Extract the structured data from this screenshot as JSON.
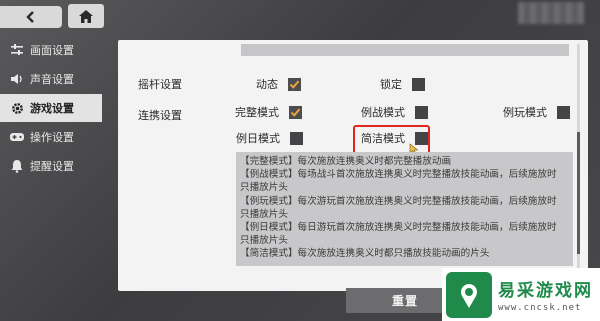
{
  "topbar": {
    "back_icon": "chevron-left",
    "home_icon": "home"
  },
  "sidebar": {
    "items": [
      {
        "label": "画面设置",
        "icon": "settings-sliders",
        "active": false
      },
      {
        "label": "声音设置",
        "icon": "speaker",
        "active": false
      },
      {
        "label": "游戏设置",
        "icon": "gear",
        "active": true
      },
      {
        "label": "操作设置",
        "icon": "gamepad",
        "active": false
      },
      {
        "label": "提醒设置",
        "icon": "bell",
        "active": false
      }
    ]
  },
  "settings": {
    "joystick": {
      "label": "摇杆设置",
      "options": [
        {
          "label": "动态",
          "checked": true
        },
        {
          "label": "锁定",
          "checked": false
        }
      ]
    },
    "combo": {
      "label": "连携设置",
      "options": [
        {
          "label": "完整模式",
          "checked": true
        },
        {
          "label": "例战模式",
          "checked": false
        },
        {
          "label": "例玩模式",
          "checked": false
        },
        {
          "label": "例日模式",
          "checked": false
        },
        {
          "label": "简洁模式",
          "checked": false
        }
      ]
    },
    "description_lines": [
      "【完整模式】每次施放连携奥义时都完整播放动画",
      "【例战模式】每场战斗首次施放连携奥义时完整播放技能动画，后续施放时",
      "只播放片头",
      "【例玩模式】每次游玩首次施放连携奥义时完整播放技能动画，后续施放时",
      "只播放片头",
      "【例日模式】每日游玩首次施放连携奥义时完整播放技能动画，后续施放时",
      "只播放片头",
      "【简洁模式】每次施放连携奥义时都只播放技能动画的片头"
    ]
  },
  "reset_label": "重置",
  "watermark": {
    "title": "易采游戏网",
    "url": "www.cncsk.net"
  },
  "colors": {
    "accent_check": "#e8a33b",
    "highlight": "#e0261f",
    "panel_bg": "#f3f3f3"
  }
}
